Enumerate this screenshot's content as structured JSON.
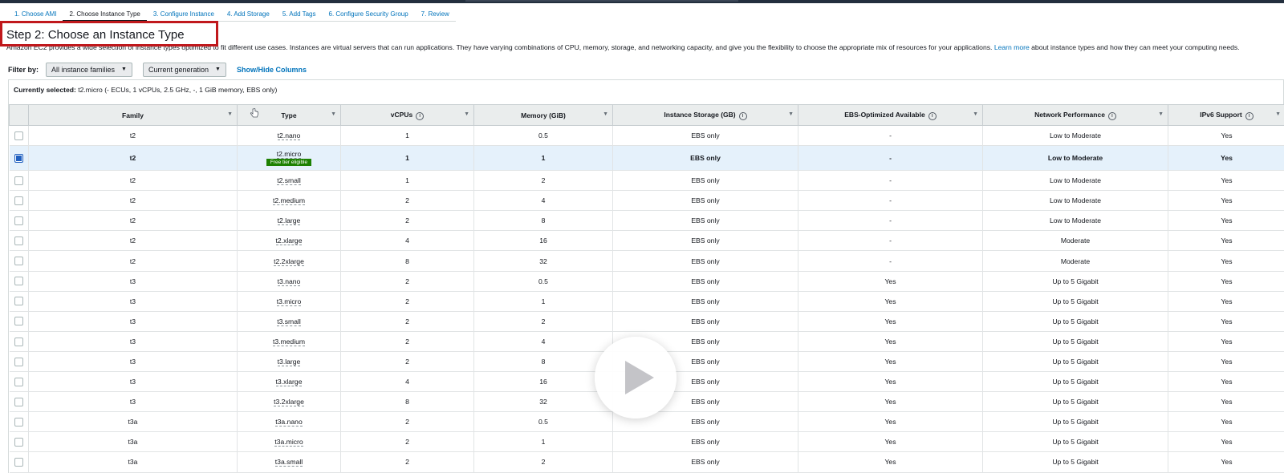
{
  "steps": [
    {
      "label": "1. Choose AMI"
    },
    {
      "label": "2. Choose Instance Type"
    },
    {
      "label": "3. Configure Instance"
    },
    {
      "label": "4. Add Storage"
    },
    {
      "label": "5. Add Tags"
    },
    {
      "label": "6. Configure Security Group"
    },
    {
      "label": "7. Review"
    }
  ],
  "active_step": 1,
  "page_title": "Step 2: Choose an Instance Type",
  "description": {
    "text": "Amazon EC2 provides a wide selection of instance types optimized to fit different use cases. Instances are virtual servers that can run applications. They have varying combinations of CPU, memory, storage, and networking capacity, and give you the flexibility to choose the appropriate mix of resources for your applications.",
    "link": "Learn more",
    "tail": "about instance types and how they can meet your computing needs."
  },
  "filter": {
    "label": "Filter by:",
    "family_select": "All instance families",
    "generation_select": "Current generation",
    "columns_link": "Show/Hide Columns"
  },
  "selection": {
    "label": "Currently selected:",
    "value": "t2.micro (- ECUs, 1 vCPUs, 2.5 GHz, -, 1 GiB memory, EBS only)"
  },
  "table": {
    "columns": [
      "Family",
      "Type",
      "vCPUs",
      "Memory (GiB)",
      "Instance Storage (GB)",
      "EBS-Optimized Available",
      "Network Performance",
      "IPv6 Support"
    ],
    "free_tier_badge": "Free tier eligible",
    "rows": [
      {
        "family": "t2",
        "type": "t2.nano",
        "vcpus": "1",
        "memory": "0.5",
        "storage": "EBS only",
        "ebs": "-",
        "network": "Low to Moderate",
        "ipv6": "Yes"
      },
      {
        "family": "t2",
        "type": "t2.micro",
        "vcpus": "1",
        "memory": "1",
        "storage": "EBS only",
        "ebs": "-",
        "network": "Low to Moderate",
        "ipv6": "Yes",
        "selected": true,
        "free_tier": true
      },
      {
        "family": "t2",
        "type": "t2.small",
        "vcpus": "1",
        "memory": "2",
        "storage": "EBS only",
        "ebs": "-",
        "network": "Low to Moderate",
        "ipv6": "Yes"
      },
      {
        "family": "t2",
        "type": "t2.medium",
        "vcpus": "2",
        "memory": "4",
        "storage": "EBS only",
        "ebs": "-",
        "network": "Low to Moderate",
        "ipv6": "Yes"
      },
      {
        "family": "t2",
        "type": "t2.large",
        "vcpus": "2",
        "memory": "8",
        "storage": "EBS only",
        "ebs": "-",
        "network": "Low to Moderate",
        "ipv6": "Yes"
      },
      {
        "family": "t2",
        "type": "t2.xlarge",
        "vcpus": "4",
        "memory": "16",
        "storage": "EBS only",
        "ebs": "-",
        "network": "Moderate",
        "ipv6": "Yes"
      },
      {
        "family": "t2",
        "type": "t2.2xlarge",
        "vcpus": "8",
        "memory": "32",
        "storage": "EBS only",
        "ebs": "-",
        "network": "Moderate",
        "ipv6": "Yes"
      },
      {
        "family": "t3",
        "type": "t3.nano",
        "vcpus": "2",
        "memory": "0.5",
        "storage": "EBS only",
        "ebs": "Yes",
        "network": "Up to 5 Gigabit",
        "ipv6": "Yes"
      },
      {
        "family": "t3",
        "type": "t3.micro",
        "vcpus": "2",
        "memory": "1",
        "storage": "EBS only",
        "ebs": "Yes",
        "network": "Up to 5 Gigabit",
        "ipv6": "Yes"
      },
      {
        "family": "t3",
        "type": "t3.small",
        "vcpus": "2",
        "memory": "2",
        "storage": "EBS only",
        "ebs": "Yes",
        "network": "Up to 5 Gigabit",
        "ipv6": "Yes"
      },
      {
        "family": "t3",
        "type": "t3.medium",
        "vcpus": "2",
        "memory": "4",
        "storage": "EBS only",
        "ebs": "Yes",
        "network": "Up to 5 Gigabit",
        "ipv6": "Yes"
      },
      {
        "family": "t3",
        "type": "t3.large",
        "vcpus": "2",
        "memory": "8",
        "storage": "EBS only",
        "ebs": "Yes",
        "network": "Up to 5 Gigabit",
        "ipv6": "Yes"
      },
      {
        "family": "t3",
        "type": "t3.xlarge",
        "vcpus": "4",
        "memory": "16",
        "storage": "EBS only",
        "ebs": "Yes",
        "network": "Up to 5 Gigabit",
        "ipv6": "Yes"
      },
      {
        "family": "t3",
        "type": "t3.2xlarge",
        "vcpus": "8",
        "memory": "32",
        "storage": "EBS only",
        "ebs": "Yes",
        "network": "Up to 5 Gigabit",
        "ipv6": "Yes"
      },
      {
        "family": "t3a",
        "type": "t3a.nano",
        "vcpus": "2",
        "memory": "0.5",
        "storage": "EBS only",
        "ebs": "Yes",
        "network": "Up to 5 Gigabit",
        "ipv6": "Yes"
      },
      {
        "family": "t3a",
        "type": "t3a.micro",
        "vcpus": "2",
        "memory": "1",
        "storage": "EBS only",
        "ebs": "Yes",
        "network": "Up to 5 Gigabit",
        "ipv6": "Yes"
      },
      {
        "family": "t3a",
        "type": "t3a.small",
        "vcpus": "2",
        "memory": "2",
        "storage": "EBS only",
        "ebs": "Yes",
        "network": "Up to 5 Gigabit",
        "ipv6": "Yes"
      }
    ]
  },
  "icons": {
    "play": "play-icon",
    "sort": "sort-icon",
    "info": "info-icon",
    "cursor": "hand-cursor-icon"
  },
  "colors": {
    "accent": "#0073bb",
    "highlight": "#c0181c",
    "selected_row": "#e5f1fb",
    "badge": "#1d8102"
  }
}
